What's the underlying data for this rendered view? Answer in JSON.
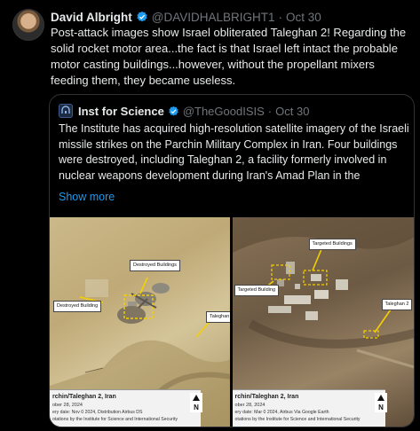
{
  "post": {
    "author_name": "David Albright",
    "author_handle": "@DAVIDHALBRIGHT1",
    "time": "Oct 30",
    "separator": "·",
    "text": "Post-attack images show Israel obliterated Taleghan 2!  Regarding the solid rocket motor area...the fact is that Israel left intact the probable motor casting buildings...however, without the propellant mixers feeding them, they became useless."
  },
  "quote": {
    "author_name": "Inst for Science",
    "author_handle": "@TheGoodISIS",
    "time": "Oct 30",
    "separator": "·",
    "text": "The Institute has acquired high-resolution satellite imagery of the Israeli missile strikes on the Parchin Military Complex in Iran.  Four buildings were destroyed, including Taleghan 2, a facility formerly involved in nuclear weapons development during Iran's Amad Plan in the",
    "show_more": "Show more"
  },
  "images": {
    "left": {
      "tags": {
        "destroyed1": "Destroyed Buildings",
        "destroyed2": "Destroyed Building",
        "taleghan": "Taleghan"
      },
      "caption_title": "rchin/Taleghan 2, Iran",
      "caption_date": "ober 28, 2024",
      "caption_credit": "ery date: Nov 0 2024, Distribution Airbus DS",
      "caption_note": "otations by the Institute for Science and International Security",
      "north_label": "N"
    },
    "right": {
      "tags": {
        "targeted1": "Targeted Buildings",
        "targeted2": "Targeted Building",
        "taleghan": "Taleghan 2"
      },
      "caption_title": "rchin/Taleghan 2, Iran",
      "caption_date": "ober 28, 2024",
      "caption_credit": "ery date: Mar 0 2024, Airbus Via Google Earth",
      "caption_note": "otations by the Institute for Science and International Security",
      "north_label": "N"
    }
  },
  "colors": {
    "accent": "#1d9bf0",
    "muted": "#71767b",
    "background": "#000000",
    "annotation": "#f5d000"
  },
  "icons": {
    "verified": "verified-badge-icon",
    "org": "institute-logo-icon",
    "north": "north-arrow-icon"
  }
}
